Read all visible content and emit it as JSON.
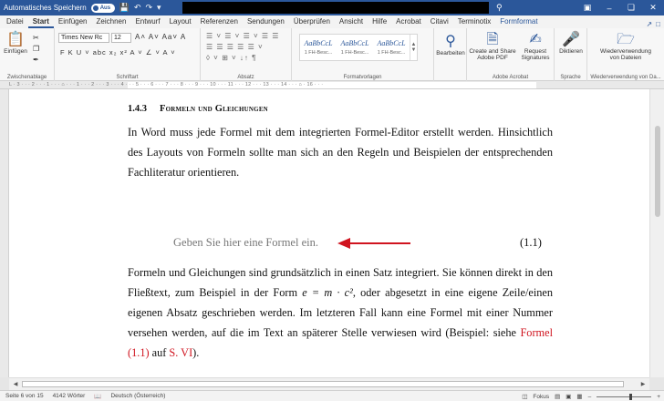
{
  "titlebar": {
    "autosave_label": "Automatisches Speichern",
    "autosave_state": "Aus",
    "save_icon": "save-icon",
    "undo_icon": "undo-icon"
  },
  "tabs": [
    {
      "label": "Datei"
    },
    {
      "label": "Start"
    },
    {
      "label": "Einfügen"
    },
    {
      "label": "Zeichnen"
    },
    {
      "label": "Entwurf"
    },
    {
      "label": "Layout"
    },
    {
      "label": "Referenzen"
    },
    {
      "label": "Sendungen"
    },
    {
      "label": "Überprüfen"
    },
    {
      "label": "Ansicht"
    },
    {
      "label": "Hilfe"
    },
    {
      "label": "Acrobat"
    },
    {
      "label": "Citavi"
    },
    {
      "label": "Terminotix"
    },
    {
      "label": "Formformat"
    }
  ],
  "ribbon": {
    "paste_label": "Einfügen",
    "clipboard_label": "Zwischenablage",
    "font_name": "Times New Rc",
    "font_size": "12",
    "font_group_label": "Schriftart",
    "font_row1": "A˄ A˅ Aa˅ A",
    "font_row2": "F  K  U ˅ abc  x₂  x²  A ˅ ∠ ˅ A ˅",
    "paragraph_row1": "☰ ˅ ☰ ˅ ☰ ˅  ☰ ☰",
    "paragraph_row2": "☰  ☰  ☰  ☰  ☰ ˅",
    "paragraph_row3": "◊ ˅ ⊞ ˅  ↓↑  ¶",
    "paragraph_label": "Absatz",
    "styles": [
      {
        "sample": "AaBbCcL",
        "name": "1 FH-Besc..."
      },
      {
        "sample": "AaBbCcL",
        "name": "1 FH-Besc..."
      },
      {
        "sample": "AaBbCcL",
        "name": "1 FH-Besc..."
      }
    ],
    "styles_label": "Formatvorlagen",
    "edit_label": "Bearbeiten",
    "acrobat_create": "Create and Share\nAdobe PDF",
    "acrobat_request": "Request\nSignatures",
    "acrobat_label": "Adobe Acrobat",
    "dictate_label": "Diktieren",
    "speech_label": "Sprache",
    "reuse_label": "Wiederverwendung\nvon Dateien",
    "reuse_group_label": "Wiederverwendung von Da..."
  },
  "ruler_text": "L  · 3 · · · 2 · · · 1 · · · ⌂ · · · 1 · · · 2 · · · 3 · · · 4 · · · 5 · · · 6 · · · 7 · · · 8 · · · 9 · · · 10 · · · 11 · · · 12 · · · 13 · · · 14 · · · ⌂ · 16 · · ·",
  "document": {
    "heading_number": "1.4.3",
    "heading_title": "Formeln und Gleichungen",
    "paragraph1": "In Word muss jede Formel mit dem integrierten Formel-Editor erstellt werden. Hinsichtlich des Layouts von Formeln sollte man sich an den Regeln und Beispielen der entsprechenden Fachliteratur orientieren.",
    "formula_placeholder": "Geben Sie hier eine Formel ein.",
    "formula_number": "(1.1)",
    "paragraph2_part1": "Formeln und Gleichungen sind grundsätzlich in einen Satz integriert. Sie können direkt in den Fließtext, zum Beispiel in der Form ",
    "paragraph2_math": "e = m · c²",
    "paragraph2_part2": ", oder abgesetzt in eine eigene Zeile/einen eigenen Absatz geschrieben werden. Im letzteren Fall kann eine Formel mit einer Nummer versehen werden, auf die im Text an späterer Stelle verwiesen wird (Beispiel: siehe ",
    "paragraph2_ref1": "Formel (1.1)",
    "paragraph2_mid": " auf ",
    "paragraph2_ref2": "S. VI",
    "paragraph2_end": ")."
  },
  "statusbar": {
    "page": "Seite 6 von 15",
    "words": "4142 Wörter",
    "language": "Deutsch (Österreich)",
    "focus": "Fokus"
  },
  "colors": {
    "accent": "#2b579a",
    "reference_red": "#d0141f",
    "arrow_red": "#d0141f"
  }
}
